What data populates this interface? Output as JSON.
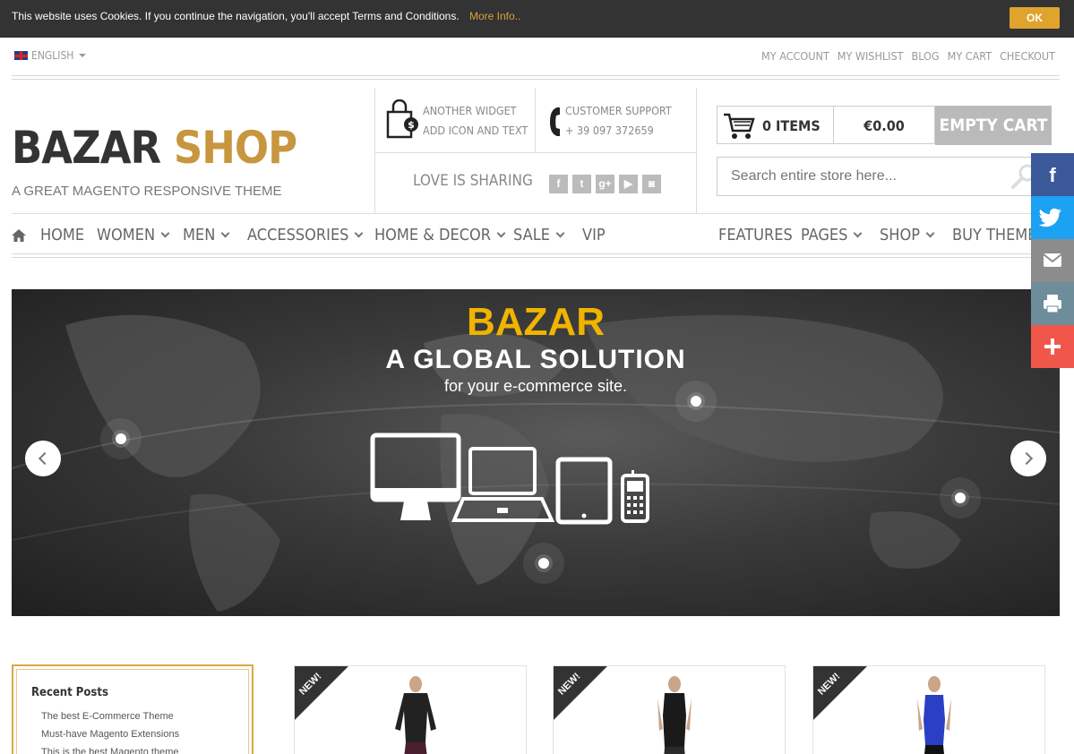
{
  "cookie": {
    "message": "This website uses Cookies. If you continue the navigation, you'll accept Terms and Conditions.",
    "more_info": "More Info..",
    "ok": "OK"
  },
  "language": {
    "selected": "ENGLISH"
  },
  "top_links": [
    "MY ACCOUNT",
    "MY WISHLIST",
    "BLOG",
    "MY CART",
    "CHECKOUT"
  ],
  "logo": {
    "part1": "BAZAR",
    "part2": "SHOP",
    "tagline": "A GREAT MAGENTO RESPONSIVE THEME"
  },
  "widgets": {
    "another_line1": "ANOTHER WIDGET",
    "another_line2": "ADD ICON AND TEXT",
    "support_line1": "CUSTOMER SUPPORT",
    "support_line2": "+ 39 097 372659",
    "sharing_label": "LOVE IS SHARING",
    "social_icons": [
      "facebook",
      "twitter",
      "google-plus",
      "youtube",
      "instagram"
    ]
  },
  "cart": {
    "items": "0 ITEMS",
    "total": "€0.00",
    "empty": "EMPTY CART"
  },
  "search": {
    "placeholder": "Search entire store here..."
  },
  "nav": {
    "left": [
      "HOME",
      "WOMEN",
      "MEN",
      "ACCESSORIES",
      "HOME & DECOR",
      "SALE",
      "VIP"
    ],
    "right": [
      "FEATURES",
      "PAGES",
      "SHOP",
      "BUY THEME"
    ]
  },
  "hero": {
    "title": "BAZAR",
    "subtitle": "A GLOBAL SOLUTION",
    "description": "for your e-commerce site."
  },
  "share_sidebar": [
    "facebook",
    "twitter",
    "email",
    "print",
    "more"
  ],
  "recent_posts": {
    "heading": "Recent Posts",
    "posts": [
      "The best E-Commerce Theme",
      "Must-have Magento Extensions",
      "This is the best Magento theme"
    ]
  },
  "products": [
    {
      "badge": "NEW!"
    },
    {
      "badge": "NEW!"
    },
    {
      "badge": "NEW!"
    }
  ],
  "colors": {
    "accent": "#c8963e",
    "hero_title": "#f0b400",
    "cookie_ok": "#e0a32e"
  }
}
